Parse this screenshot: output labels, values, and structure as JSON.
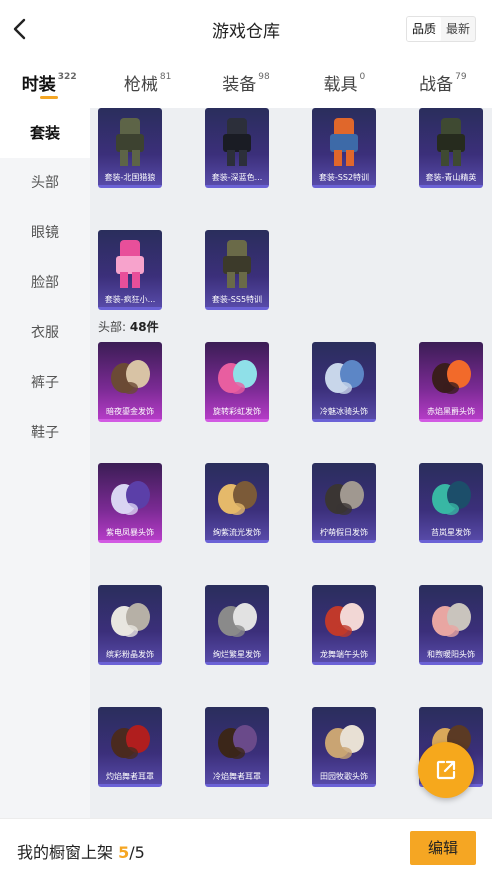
{
  "header": {
    "title": "游戏仓库",
    "sort": [
      "品质",
      "最新"
    ]
  },
  "tabs": [
    {
      "label": "时装",
      "count": "322"
    },
    {
      "label": "枪械",
      "count": "81"
    },
    {
      "label": "装备",
      "count": "98"
    },
    {
      "label": "载具",
      "count": "0"
    },
    {
      "label": "战备",
      "count": "79"
    }
  ],
  "sidebar": [
    "套装",
    "头部",
    "眼镜",
    "脸部",
    "衣服",
    "裤子",
    "鞋子"
  ],
  "sections": {
    "head_label": "头部:",
    "head_count": "48件"
  },
  "outfits": [
    {
      "name": "套装-北国猎狼",
      "art": "jacket-olive"
    },
    {
      "name": "套装-深蓝色...",
      "art": "suit-dark"
    },
    {
      "name": "套装-SS2特训",
      "art": "figure-orange"
    },
    {
      "name": "套装-青山精英",
      "art": "jacket-green"
    },
    {
      "name": "套装-疯狂小...",
      "art": "figure-pink"
    },
    {
      "name": "套装-SS5特训",
      "art": "figure-camo"
    }
  ],
  "heads": [
    {
      "name": "暗夜鎏金发饰",
      "rarity": "purple",
      "art": "hair-brown"
    },
    {
      "name": "旋转彩虹发饰",
      "rarity": "purple",
      "art": "hair-rainbow"
    },
    {
      "name": "冷魅冰骑头饰",
      "rarity": "blue",
      "art": "helm-ice"
    },
    {
      "name": "赤焰黑爵头饰",
      "rarity": "purple",
      "art": "helm-fire"
    },
    {
      "name": "紫电凤暴头饰",
      "rarity": "purple",
      "art": "helm-violet"
    },
    {
      "name": "绚紫流光发饰",
      "rarity": "blue",
      "art": "hair-blonde"
    },
    {
      "name": "柠萌假日发饰",
      "rarity": "blue",
      "art": "hair-dark"
    },
    {
      "name": "苔岚星发饰",
      "rarity": "blue",
      "art": "hair-teal"
    },
    {
      "name": "缤彩粉晶发饰",
      "rarity": "blue",
      "art": "hair-white"
    },
    {
      "name": "绚烂繁星发饰",
      "rarity": "blue",
      "art": "hair-gray"
    },
    {
      "name": "龙舞端午头饰",
      "rarity": "blue",
      "art": "cap-red"
    },
    {
      "name": "和煦暖阳头饰",
      "rarity": "blue",
      "art": "hair-pink"
    },
    {
      "name": "灼焰舞者耳罩",
      "rarity": "blue",
      "art": "hair-braid"
    },
    {
      "name": "冷焰舞者耳罩",
      "rarity": "blue",
      "art": "hair-braid2"
    },
    {
      "name": "田园牧歌头饰",
      "rarity": "blue",
      "art": "hat-straw"
    },
    {
      "name": "",
      "rarity": "blue",
      "art": "hair-braid-gold"
    }
  ],
  "bottom": {
    "showcase_label": "我的橱窗上架 ",
    "current": "5",
    "total": "/5",
    "edit": "编辑"
  },
  "icons": {
    "back": "chevron-left-icon",
    "share": "share-external-icon"
  },
  "colors": {
    "accent": "#f5a623",
    "card_blue": "#574aa8",
    "card_purple": "#b43cc6"
  }
}
